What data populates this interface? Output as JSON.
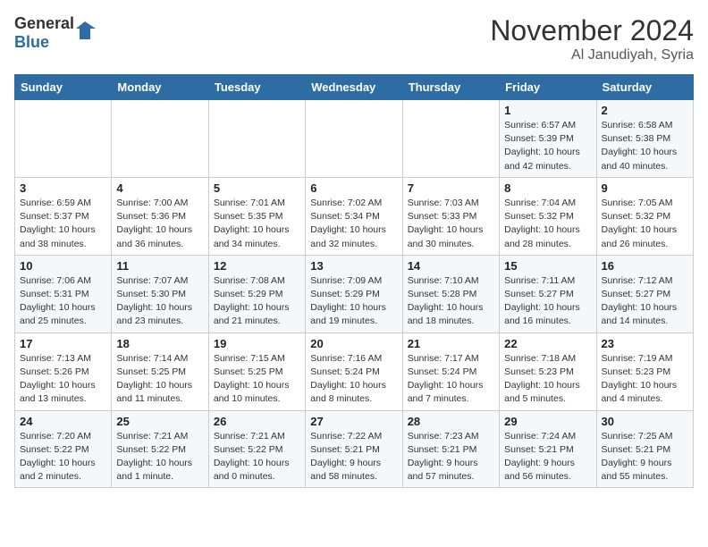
{
  "header": {
    "logo_general": "General",
    "logo_blue": "Blue",
    "month_title": "November 2024",
    "location": "Al Janudiyah, Syria"
  },
  "weekdays": [
    "Sunday",
    "Monday",
    "Tuesday",
    "Wednesday",
    "Thursday",
    "Friday",
    "Saturday"
  ],
  "weeks": [
    [
      {
        "day": "",
        "info": ""
      },
      {
        "day": "",
        "info": ""
      },
      {
        "day": "",
        "info": ""
      },
      {
        "day": "",
        "info": ""
      },
      {
        "day": "",
        "info": ""
      },
      {
        "day": "1",
        "info": "Sunrise: 6:57 AM\nSunset: 5:39 PM\nDaylight: 10 hours\nand 42 minutes."
      },
      {
        "day": "2",
        "info": "Sunrise: 6:58 AM\nSunset: 5:38 PM\nDaylight: 10 hours\nand 40 minutes."
      }
    ],
    [
      {
        "day": "3",
        "info": "Sunrise: 6:59 AM\nSunset: 5:37 PM\nDaylight: 10 hours\nand 38 minutes."
      },
      {
        "day": "4",
        "info": "Sunrise: 7:00 AM\nSunset: 5:36 PM\nDaylight: 10 hours\nand 36 minutes."
      },
      {
        "day": "5",
        "info": "Sunrise: 7:01 AM\nSunset: 5:35 PM\nDaylight: 10 hours\nand 34 minutes."
      },
      {
        "day": "6",
        "info": "Sunrise: 7:02 AM\nSunset: 5:34 PM\nDaylight: 10 hours\nand 32 minutes."
      },
      {
        "day": "7",
        "info": "Sunrise: 7:03 AM\nSunset: 5:33 PM\nDaylight: 10 hours\nand 30 minutes."
      },
      {
        "day": "8",
        "info": "Sunrise: 7:04 AM\nSunset: 5:32 PM\nDaylight: 10 hours\nand 28 minutes."
      },
      {
        "day": "9",
        "info": "Sunrise: 7:05 AM\nSunset: 5:32 PM\nDaylight: 10 hours\nand 26 minutes."
      }
    ],
    [
      {
        "day": "10",
        "info": "Sunrise: 7:06 AM\nSunset: 5:31 PM\nDaylight: 10 hours\nand 25 minutes."
      },
      {
        "day": "11",
        "info": "Sunrise: 7:07 AM\nSunset: 5:30 PM\nDaylight: 10 hours\nand 23 minutes."
      },
      {
        "day": "12",
        "info": "Sunrise: 7:08 AM\nSunset: 5:29 PM\nDaylight: 10 hours\nand 21 minutes."
      },
      {
        "day": "13",
        "info": "Sunrise: 7:09 AM\nSunset: 5:29 PM\nDaylight: 10 hours\nand 19 minutes."
      },
      {
        "day": "14",
        "info": "Sunrise: 7:10 AM\nSunset: 5:28 PM\nDaylight: 10 hours\nand 18 minutes."
      },
      {
        "day": "15",
        "info": "Sunrise: 7:11 AM\nSunset: 5:27 PM\nDaylight: 10 hours\nand 16 minutes."
      },
      {
        "day": "16",
        "info": "Sunrise: 7:12 AM\nSunset: 5:27 PM\nDaylight: 10 hours\nand 14 minutes."
      }
    ],
    [
      {
        "day": "17",
        "info": "Sunrise: 7:13 AM\nSunset: 5:26 PM\nDaylight: 10 hours\nand 13 minutes."
      },
      {
        "day": "18",
        "info": "Sunrise: 7:14 AM\nSunset: 5:25 PM\nDaylight: 10 hours\nand 11 minutes."
      },
      {
        "day": "19",
        "info": "Sunrise: 7:15 AM\nSunset: 5:25 PM\nDaylight: 10 hours\nand 10 minutes."
      },
      {
        "day": "20",
        "info": "Sunrise: 7:16 AM\nSunset: 5:24 PM\nDaylight: 10 hours\nand 8 minutes."
      },
      {
        "day": "21",
        "info": "Sunrise: 7:17 AM\nSunset: 5:24 PM\nDaylight: 10 hours\nand 7 minutes."
      },
      {
        "day": "22",
        "info": "Sunrise: 7:18 AM\nSunset: 5:23 PM\nDaylight: 10 hours\nand 5 minutes."
      },
      {
        "day": "23",
        "info": "Sunrise: 7:19 AM\nSunset: 5:23 PM\nDaylight: 10 hours\nand 4 minutes."
      }
    ],
    [
      {
        "day": "24",
        "info": "Sunrise: 7:20 AM\nSunset: 5:22 PM\nDaylight: 10 hours\nand 2 minutes."
      },
      {
        "day": "25",
        "info": "Sunrise: 7:21 AM\nSunset: 5:22 PM\nDaylight: 10 hours\nand 1 minute."
      },
      {
        "day": "26",
        "info": "Sunrise: 7:21 AM\nSunset: 5:22 PM\nDaylight: 10 hours\nand 0 minutes."
      },
      {
        "day": "27",
        "info": "Sunrise: 7:22 AM\nSunset: 5:21 PM\nDaylight: 9 hours\nand 58 minutes."
      },
      {
        "day": "28",
        "info": "Sunrise: 7:23 AM\nSunset: 5:21 PM\nDaylight: 9 hours\nand 57 minutes."
      },
      {
        "day": "29",
        "info": "Sunrise: 7:24 AM\nSunset: 5:21 PM\nDaylight: 9 hours\nand 56 minutes."
      },
      {
        "day": "30",
        "info": "Sunrise: 7:25 AM\nSunset: 5:21 PM\nDaylight: 9 hours\nand 55 minutes."
      }
    ]
  ]
}
